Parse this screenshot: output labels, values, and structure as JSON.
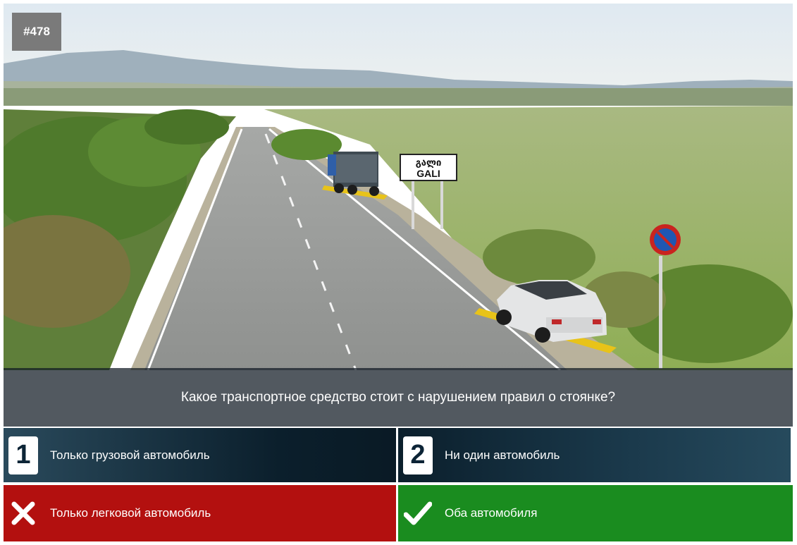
{
  "question_id": "#478",
  "sign_text": {
    "line1": "გალი",
    "line2": "GALI"
  },
  "question": "Какое транспортное средство стоит с нарушением правил о стоянке?",
  "answers": [
    {
      "number": "1",
      "label": "Только грузовой автомобиль",
      "state": "neutral"
    },
    {
      "number": "2",
      "label": "Ни один автомобиль",
      "state": "neutral"
    },
    {
      "label": "Только легковой автомобиль",
      "state": "wrong",
      "icon": "cross-icon"
    },
    {
      "label": "Оба автомобиля",
      "state": "correct",
      "icon": "check-icon"
    }
  ],
  "colors": {
    "wrong": "#b3100f",
    "correct": "#1a8c1f",
    "neutral": "#0b1f2c"
  }
}
